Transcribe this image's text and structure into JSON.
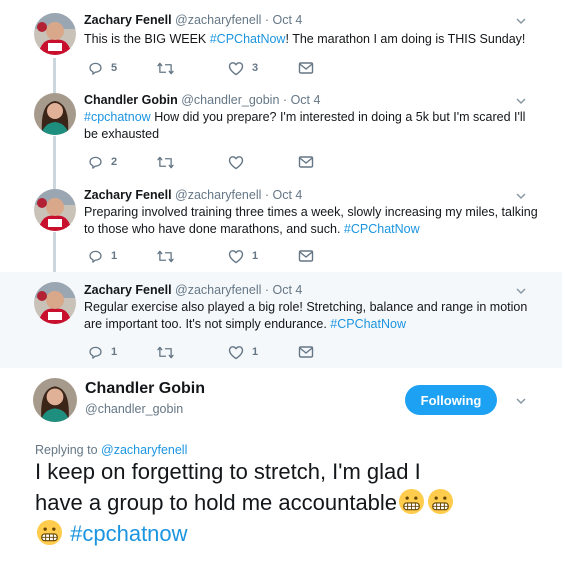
{
  "thread": [
    {
      "name": "Zachary Fenell",
      "handle": "@zacharyfenell",
      "separator": "·",
      "date": "Oct 4",
      "text_parts": [
        {
          "text": "This is the BIG WEEK ",
          "tag": false
        },
        {
          "text": "#CPChatNow",
          "tag": true
        },
        {
          "text": "! The marathon I am doing is THIS Sunday!",
          "tag": false
        }
      ],
      "reply_count": "5",
      "retweet_count": "",
      "like_count": "3"
    },
    {
      "name": "Chandler Gobin",
      "handle": "@chandler_gobin",
      "separator": "·",
      "date": "Oct 4",
      "text_parts": [
        {
          "text": "#cpchatnow",
          "tag": true
        },
        {
          "text": " How did you prepare? I'm interested in doing a 5k but I'm scared I'll be exhausted",
          "tag": false
        }
      ],
      "reply_count": "2",
      "retweet_count": "",
      "like_count": ""
    },
    {
      "name": "Zachary Fenell",
      "handle": "@zacharyfenell",
      "separator": "·",
      "date": "Oct 4",
      "text_parts": [
        {
          "text": "Preparing involved training three times a week, slowly increasing my miles, talking to those who have done marathons, and such. ",
          "tag": false
        },
        {
          "text": "#CPChatNow",
          "tag": true
        }
      ],
      "reply_count": "1",
      "retweet_count": "",
      "like_count": "1"
    },
    {
      "name": "Zachary Fenell",
      "handle": "@zacharyfenell",
      "separator": "·",
      "date": "Oct 4",
      "text_parts": [
        {
          "text": "Regular exercise also played a big role! Stretching, balance and range in motion are important too. It's not simply endurance. ",
          "tag": false
        },
        {
          "text": "#CPChatNow",
          "tag": true
        }
      ],
      "reply_count": "1",
      "retweet_count": "",
      "like_count": "1"
    }
  ],
  "main": {
    "name": "Chandler Gobin",
    "handle": "@chandler_gobin",
    "follow_label": "Following",
    "replying_prefix": "Replying to ",
    "replying_to": "@zacharyfenell",
    "text_line1": "I keep on forgetting to stretch, I'm glad I",
    "text_line2": "have a group to hold me accountable",
    "hashtag": "#cpchatnow"
  },
  "icons": {
    "reply": "reply-icon",
    "retweet": "retweet-icon",
    "like": "heart-icon",
    "message": "envelope-icon",
    "menu": "chevron-down-icon",
    "emoji": "grimacing-face-emoji"
  },
  "colors": {
    "link": "#1b95e0",
    "follow_button": "#1da1f2",
    "secondary_text": "#657786",
    "shaded_background": "#f5f8fa",
    "thread_line": "#ccd6dd"
  }
}
